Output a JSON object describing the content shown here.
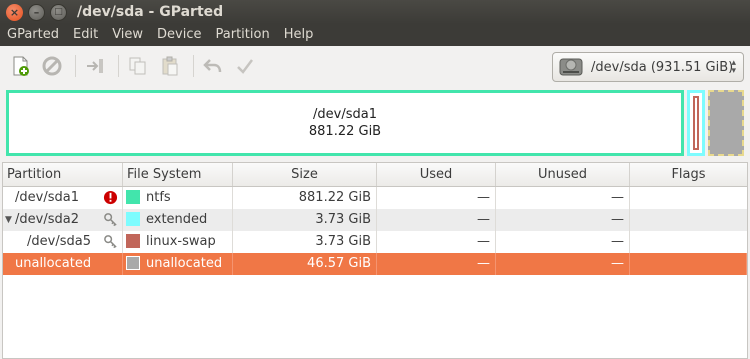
{
  "window": {
    "title": "/dev/sda - GParted"
  },
  "menu": [
    "GParted",
    "Edit",
    "View",
    "Device",
    "Partition",
    "Help"
  ],
  "toolbar": {
    "icons": [
      "new-partition-icon",
      "delete-icon",
      "resize-move-icon",
      "copy-icon",
      "paste-icon",
      "undo-icon",
      "apply-icon"
    ]
  },
  "device_selector": {
    "label": "/dev/sda  (931.51 GiB)",
    "icon": "harddisk-icon"
  },
  "diskmap": {
    "sda1_name": "/dev/sda1",
    "sda1_size": "881.22 GiB",
    "colors": {
      "ntfs": "#42e5ac",
      "extended": "#7dfcfe",
      "swap": "#c1665a",
      "unallocated": "#a9a9a9"
    }
  },
  "table": {
    "headers": [
      "Partition",
      "File System",
      "Size",
      "Used",
      "Unused",
      "Flags"
    ],
    "rows": [
      {
        "partition": "/dev/sda1",
        "fs": "ntfs",
        "size": "881.22 GiB",
        "used": "—",
        "unused": "—",
        "flags": "",
        "color": "#42e5ac",
        "status": "error-icon"
      },
      {
        "partition": "/dev/sda2",
        "fs": "extended",
        "size": "3.73 GiB",
        "used": "—",
        "unused": "—",
        "flags": "",
        "color": "#7dfcfe",
        "status": "key-icon"
      },
      {
        "partition": "/dev/sda5",
        "fs": "linux-swap",
        "size": "3.73 GiB",
        "used": "—",
        "unused": "—",
        "flags": "",
        "color": "#c1665a",
        "status": "key-icon"
      },
      {
        "partition": "unallocated",
        "fs": "unallocated",
        "size": "46.57 GiB",
        "used": "—",
        "unused": "—",
        "flags": "",
        "color": "#a9a9a9",
        "status": ""
      }
    ]
  }
}
